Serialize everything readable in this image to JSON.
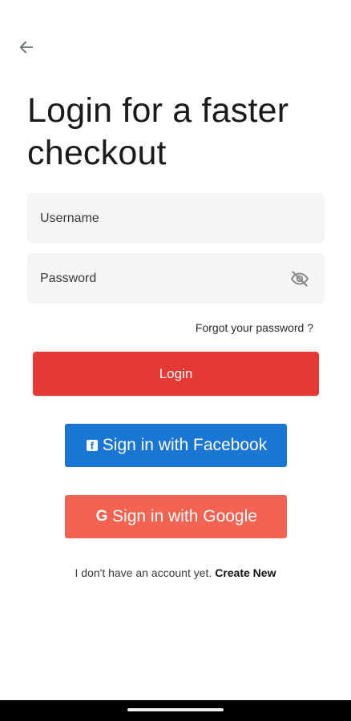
{
  "header": {
    "back_icon": "arrow-left-icon",
    "title": "Login for a faster checkout"
  },
  "form": {
    "username": {
      "placeholder": "Username",
      "value": ""
    },
    "password": {
      "placeholder": "Password",
      "value": "",
      "toggle_icon": "eye-off-icon"
    },
    "forgot_label": "Forgot your password ?",
    "login_label": "Login"
  },
  "social": {
    "facebook_label": "Sign in with Facebook",
    "facebook_icon": "facebook-icon",
    "facebook_color": "#1976d2",
    "google_label": "Sign in with Google",
    "google_icon": "google-icon",
    "google_color": "#f26351"
  },
  "signup": {
    "prompt": "I don't have an account yet.",
    "link_label": "Create New"
  },
  "colors": {
    "primary": "#e53935",
    "field_background": "#f5f5f5"
  }
}
